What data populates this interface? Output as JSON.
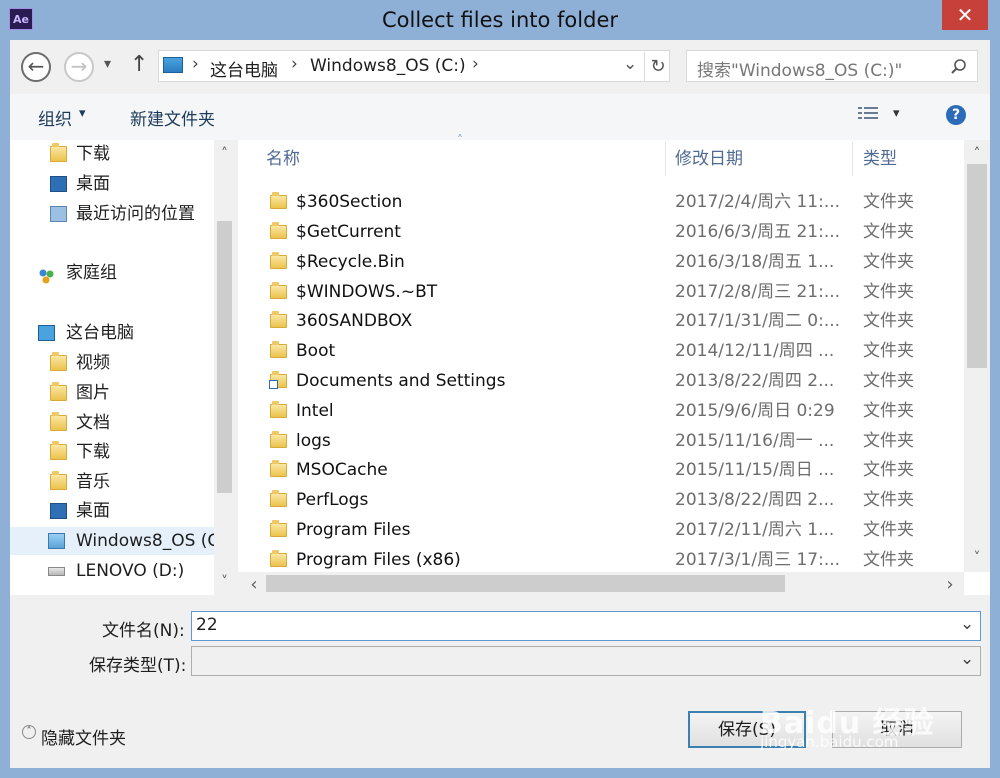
{
  "window": {
    "app_icon": "Ae",
    "title": "Collect files into folder",
    "close": "✕"
  },
  "nav": {
    "back": "←",
    "forward": "→",
    "dropdown": "▾",
    "up": "↑",
    "breadcrumb": [
      "这台电脑",
      "Windows8_OS (C:)"
    ],
    "separators": [
      "›",
      "›",
      "›"
    ],
    "addr_dropdown": "⌄",
    "refresh": "↻",
    "search_placeholder": "搜索\"Windows8_OS (C:)\""
  },
  "toolbar": {
    "organize": "组织",
    "organize_caret": "▾",
    "new_folder": "新建文件夹",
    "view_caret": "▾",
    "help": "?"
  },
  "sidebar": {
    "items": [
      {
        "label": "下载",
        "icon": "download-folder-icon"
      },
      {
        "label": "桌面",
        "icon": "desktop-icon"
      },
      {
        "label": "最近访问的位置",
        "icon": "recent-places-icon"
      },
      {
        "label": "家庭组",
        "icon": "homegroup-icon"
      },
      {
        "label": "这台电脑",
        "icon": "computer-icon"
      },
      {
        "label": "视频",
        "icon": "videos-folder-icon"
      },
      {
        "label": "图片",
        "icon": "pictures-folder-icon"
      },
      {
        "label": "文档",
        "icon": "documents-folder-icon"
      },
      {
        "label": "下载",
        "icon": "download-folder-icon"
      },
      {
        "label": "音乐",
        "icon": "music-folder-icon"
      },
      {
        "label": "桌面",
        "icon": "desktop-icon"
      },
      {
        "label": "Windows8_OS (C",
        "icon": "system-drive-icon"
      },
      {
        "label": "LENOVO (D:)",
        "icon": "drive-icon"
      }
    ]
  },
  "columns": {
    "name": "名称",
    "modified": "修改日期",
    "type": "类型",
    "sort_indicator": "˄"
  },
  "files": [
    {
      "name": "$360Section",
      "modified": "2017/2/4/周六 11:...",
      "type": "文件夹"
    },
    {
      "name": "$GetCurrent",
      "modified": "2016/6/3/周五 21:...",
      "type": "文件夹"
    },
    {
      "name": "$Recycle.Bin",
      "modified": "2016/3/18/周五 1...",
      "type": "文件夹"
    },
    {
      "name": "$WINDOWS.~BT",
      "modified": "2017/2/8/周三 21:...",
      "type": "文件夹"
    },
    {
      "name": "360SANDBOX",
      "modified": "2017/1/31/周二 0:...",
      "type": "文件夹"
    },
    {
      "name": "Boot",
      "modified": "2014/12/11/周四 ...",
      "type": "文件夹"
    },
    {
      "name": "Documents and Settings",
      "modified": "2013/8/22/周四 2...",
      "type": "文件夹"
    },
    {
      "name": "Intel",
      "modified": "2015/9/6/周日 0:29",
      "type": "文件夹"
    },
    {
      "name": "logs",
      "modified": "2015/11/16/周一 ...",
      "type": "文件夹"
    },
    {
      "name": "MSOCache",
      "modified": "2015/11/15/周日 ...",
      "type": "文件夹"
    },
    {
      "name": "PerfLogs",
      "modified": "2013/8/22/周四 2...",
      "type": "文件夹"
    },
    {
      "name": "Program Files",
      "modified": "2017/2/11/周六 1...",
      "type": "文件夹"
    },
    {
      "name": "Program Files (x86)",
      "modified": "2017/3/1/周三 17:...",
      "type": "文件夹"
    }
  ],
  "scroll": {
    "up": "˄",
    "down": "˅",
    "left": "‹",
    "right": "›"
  },
  "form": {
    "filename_label": "文件名(N):",
    "filename_value": "22",
    "filetype_label": "保存类型(T):",
    "filetype_value": "",
    "dropdown_caret": "⌄"
  },
  "footer": {
    "hide_folders_icon": "˄",
    "hide_folders": "隐藏文件夹",
    "save": "保存(S)",
    "cancel": "取消"
  },
  "watermark": {
    "brand": "Baidu 经验",
    "url": "jingyan.baidu.com"
  }
}
